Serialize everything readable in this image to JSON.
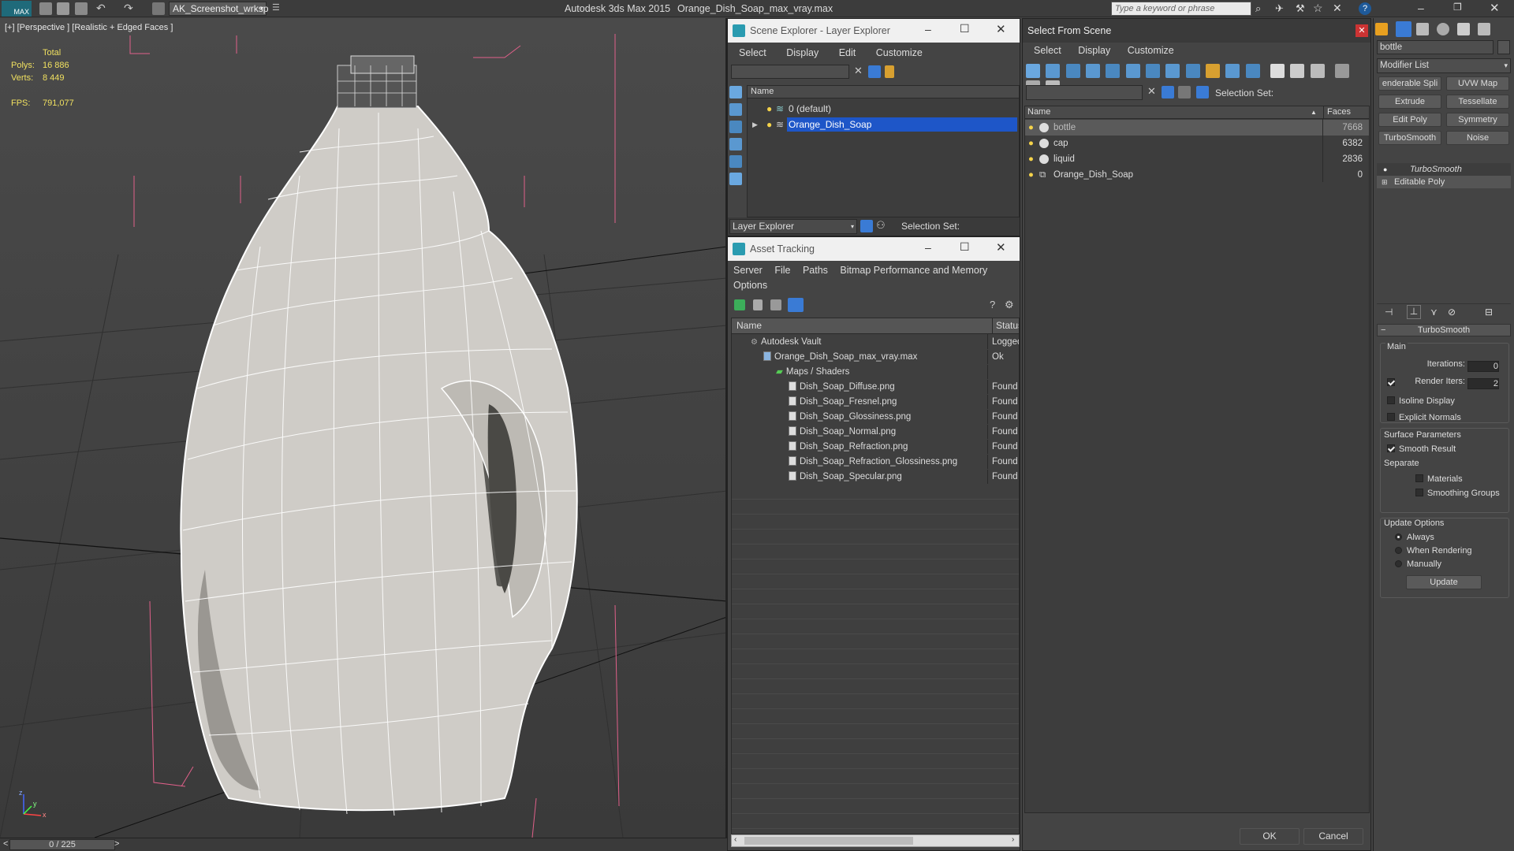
{
  "app": {
    "logo": "MAX",
    "workspace": "AK_Screenshot_wrksp",
    "title": "Autodesk 3ds Max 2015",
    "filename": "Orange_Dish_Soap_max_vray.max",
    "search_placeholder": "Type a keyword or phrase"
  },
  "viewport": {
    "label": "[+] [Perspective ] [Realistic + Edged Faces ]",
    "stats": {
      "total_label": "Total",
      "polys_label": "Polys:",
      "polys_value": "16 886",
      "verts_label": "Verts:",
      "verts_value": "8 449",
      "fps_label": "FPS:",
      "fps_value": "791,077"
    },
    "axis_x": "x",
    "axis_y": "y",
    "axis_z": "z"
  },
  "timeline": {
    "prev": "<",
    "frame": "0 / 225",
    "next": ">"
  },
  "scene_explorer": {
    "title": "Scene Explorer - Layer Explorer",
    "menu": [
      "Select",
      "Display",
      "Edit",
      "Customize"
    ],
    "column": "Name",
    "rows": [
      "0 (default)",
      "Orange_Dish_Soap"
    ],
    "footer_label": "Layer Explorer",
    "selection_set": "Selection Set:"
  },
  "asset_tracking": {
    "title": "Asset Tracking",
    "menu": [
      "Server",
      "File",
      "Paths",
      "Bitmap Performance and Memory"
    ],
    "menu2": "Options",
    "col_name": "Name",
    "col_status": "Status",
    "rows": [
      {
        "name": "Autodesk Vault",
        "status": "Logged"
      },
      {
        "name": "Orange_Dish_Soap_max_vray.max",
        "status": "Ok"
      },
      {
        "name": "Maps / Shaders",
        "status": ""
      },
      {
        "name": "Dish_Soap_Diffuse.png",
        "status": "Found"
      },
      {
        "name": "Dish_Soap_Fresnel.png",
        "status": "Found"
      },
      {
        "name": "Dish_Soap_Glossiness.png",
        "status": "Found"
      },
      {
        "name": "Dish_Soap_Normal.png",
        "status": "Found"
      },
      {
        "name": "Dish_Soap_Refraction.png",
        "status": "Found"
      },
      {
        "name": "Dish_Soap_Refraction_Glossiness.png",
        "status": "Found"
      },
      {
        "name": "Dish_Soap_Specular.png",
        "status": "Found"
      }
    ]
  },
  "select_from_scene": {
    "title": "Select From Scene",
    "menu": [
      "Select",
      "Display",
      "Customize"
    ],
    "selection_set": "Selection Set:",
    "col_name": "Name",
    "col_faces": "Faces",
    "rows": [
      {
        "name": "bottle",
        "faces": "7668"
      },
      {
        "name": "cap",
        "faces": "6382"
      },
      {
        "name": "liquid",
        "faces": "2836"
      },
      {
        "name": "Orange_Dish_Soap",
        "faces": "0"
      }
    ],
    "ok": "OK",
    "cancel": "Cancel"
  },
  "modify_panel": {
    "object_name": "bottle",
    "modifier_list": "Modifier List",
    "buttons": [
      "enderable Spli",
      "UVW Map",
      "Extrude",
      "Tessellate",
      "Edit Poly",
      "Symmetry",
      "TurboSmooth",
      "Noise"
    ],
    "stack": [
      "TurboSmooth",
      "Editable Poly"
    ],
    "rollout_title": "TurboSmooth",
    "main_label": "Main",
    "iterations_label": "Iterations:",
    "iterations_value": "0",
    "render_iters_label": "Render Iters:",
    "render_iters_value": "2",
    "isoline": "Isoline Display",
    "explicit_normals": "Explicit Normals",
    "surface_params": "Surface Parameters",
    "smooth_result": "Smooth Result",
    "separate": "Separate",
    "materials": "Materials",
    "smoothing_groups": "Smoothing Groups",
    "update_options": "Update Options",
    "always": "Always",
    "when_rendering": "When Rendering",
    "manually": "Manually",
    "update": "Update"
  }
}
